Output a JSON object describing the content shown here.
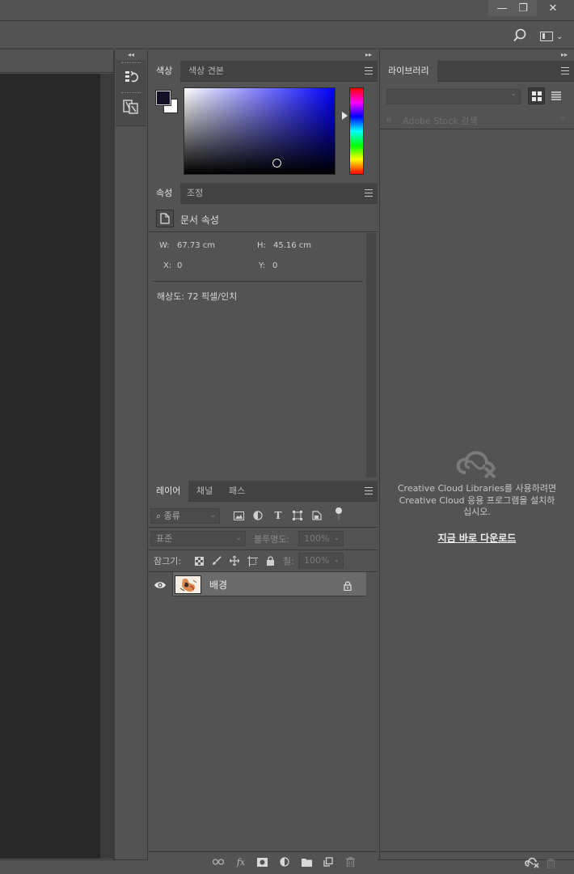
{
  "window": {
    "minimize_glyph": "—",
    "restore_glyph": "❐",
    "close_glyph": "✕"
  },
  "color_panel": {
    "tabs": [
      "색상",
      "색상 견본"
    ],
    "foreground_color": "#141126",
    "background_color": "#ffffff"
  },
  "properties_panel": {
    "tabs": [
      "속성",
      "조정"
    ],
    "title": "문서 속성",
    "w_label": "W:",
    "w_value": "67.73 cm",
    "h_label": "H:",
    "h_value": "45.16 cm",
    "x_label": "X:",
    "x_value": "0",
    "y_label": "Y:",
    "y_value": "0",
    "resolution": "해상도: 72 픽셀/인치"
  },
  "layers_panel": {
    "tabs": [
      "레이어",
      "채널",
      "패스"
    ],
    "filter_kind": "종류",
    "blend_mode": "표준",
    "opacity_label": "불투명도:",
    "opacity_value": "100%",
    "lock_label": "잠그기:",
    "fill_label": "칠:",
    "fill_value": "100%",
    "layers": [
      {
        "name": "배경",
        "visible": true,
        "locked": true
      }
    ]
  },
  "libraries_panel": {
    "tabs": [
      "라이브러리"
    ],
    "search_placeholder": "Adobe Stock 검색",
    "message_line1": "Creative Cloud Libraries를 사용하려면",
    "message_line2": "Creative Cloud 응용 프로그램을 설치하",
    "message_line3": "십시오.",
    "download_link": "지금 바로 다운로드"
  }
}
